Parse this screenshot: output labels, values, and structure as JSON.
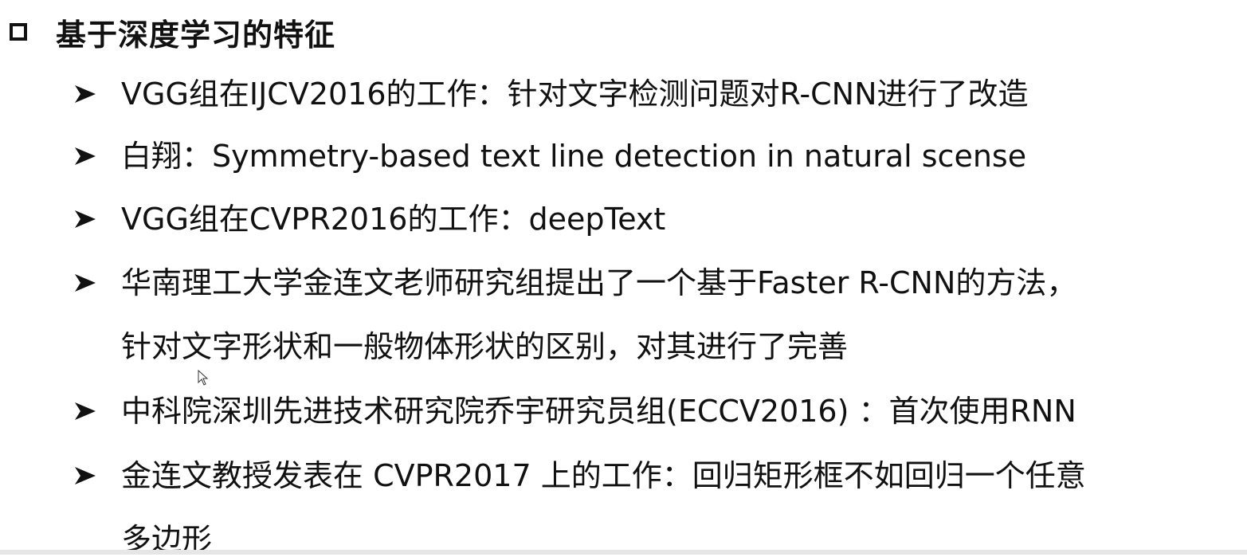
{
  "slide": {
    "heading": "基于深度学习的特征",
    "heading_icon": "hollow-square-bullet-icon",
    "bullet_icon": "arrowhead-bullet-icon",
    "bullets": [
      {
        "lines": [
          "VGG组在IJCV2016的工作：针对文字检测问题对R-CNN进行了改造"
        ]
      },
      {
        "lines": [
          "白翔：Symmetry-based text line detection in natural scense"
        ]
      },
      {
        "lines": [
          "VGG组在CVPR2016的工作：deepText"
        ]
      },
      {
        "lines": [
          "华南理工大学金连文老师研究组提出了一个基于Faster R-CNN的方法，",
          "针对文字形状和一般物体形状的区别，对其进行了完善"
        ]
      },
      {
        "lines": [
          "中科院深圳先进技术研究院乔宇研究员组(ECCV2016) ：首次使用RNN"
        ]
      },
      {
        "lines": [
          "金连文教授发表在 CVPR2017 上的工作：回归矩形框不如回归一个任意",
          "多边形"
        ]
      }
    ]
  }
}
